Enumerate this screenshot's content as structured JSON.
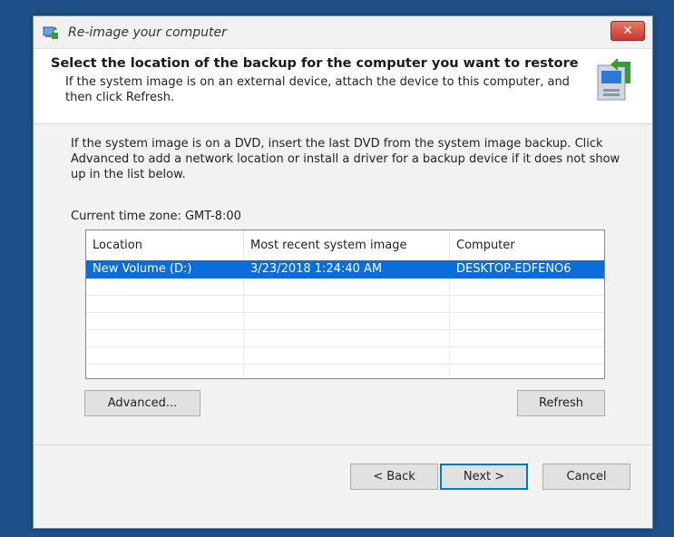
{
  "window": {
    "title": "Re-image your computer",
    "close_glyph": "✕"
  },
  "header": {
    "title": "Select the location of the backup for the computer you want to restore",
    "description": "If the system image is on an external device, attach the device to this computer, and then click Refresh."
  },
  "body": {
    "instructions": "If the system image is on a DVD, insert the last DVD from the system image backup. Click Advanced to add a network location or install a driver for a backup device if it does not show up in the list below.",
    "time_zone": "Current time zone: GMT-8:00"
  },
  "table": {
    "columns": [
      "Location",
      "Most recent system image",
      "Computer"
    ],
    "rows": [
      [
        "New Volume (D:)",
        "3/23/2018 1:24:40 AM",
        "DESKTOP-EDFENO6"
      ]
    ]
  },
  "buttons": {
    "advanced": "Advanced...",
    "refresh": "Refresh",
    "back": "< Back",
    "next": "Next >",
    "cancel": "Cancel"
  },
  "colors": {
    "desktop": "#1f5089",
    "selection": "#0a6dd8",
    "close": "#c5392a"
  }
}
